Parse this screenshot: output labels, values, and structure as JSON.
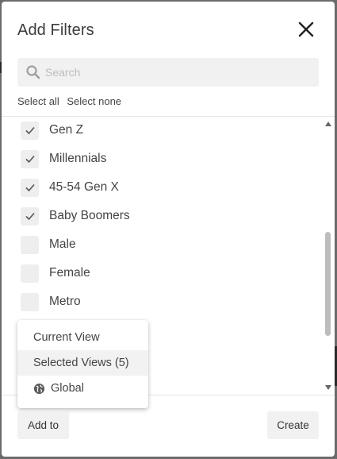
{
  "dialog": {
    "title": "Add Filters"
  },
  "search": {
    "placeholder": "Search"
  },
  "selection": {
    "select_all": "Select all",
    "select_none": "Select none"
  },
  "filters": [
    {
      "label": "Gen Z",
      "checked": true
    },
    {
      "label": "Millennials",
      "checked": true
    },
    {
      "label": "45-54 Gen X",
      "checked": true
    },
    {
      "label": "Baby Boomers",
      "checked": true
    },
    {
      "label": "Male",
      "checked": false
    },
    {
      "label": "Female",
      "checked": false
    },
    {
      "label": "Metro",
      "checked": false
    }
  ],
  "add_to_menu": {
    "items": [
      {
        "label": "Current View",
        "icon": ""
      },
      {
        "label": "Selected Views (5)",
        "icon": "",
        "highlighted": true
      },
      {
        "label": "Global",
        "icon": "globe-icon"
      }
    ]
  },
  "footer": {
    "add_to_label": "Add to",
    "create_label": "Create"
  }
}
